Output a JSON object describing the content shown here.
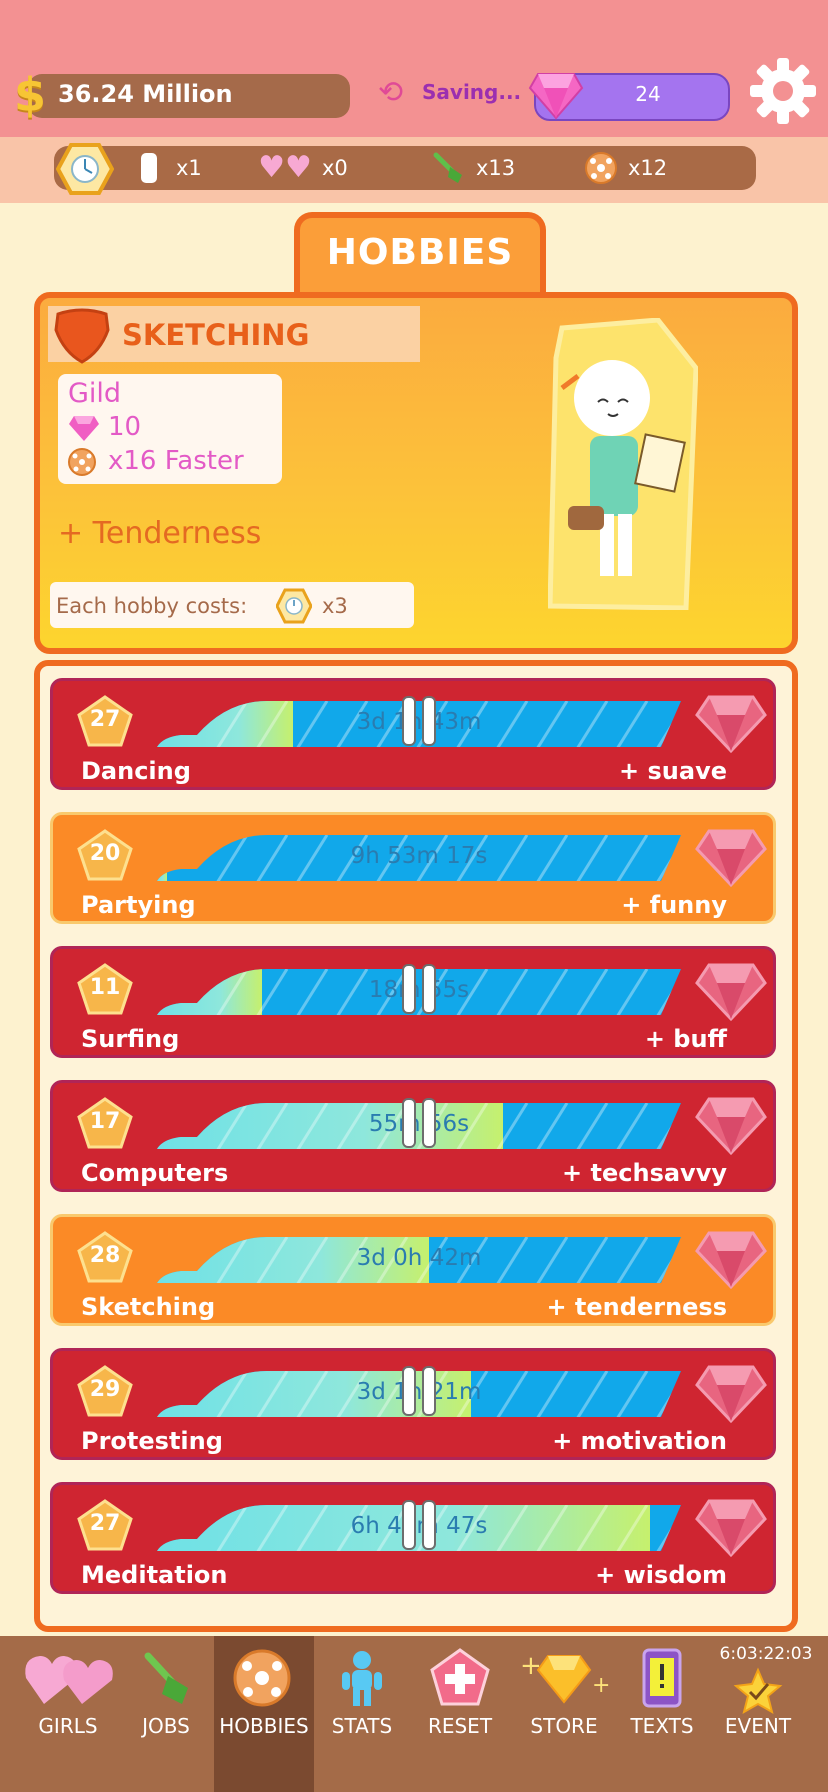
{
  "header": {
    "money": "36.24 Million",
    "saving": "Saving...",
    "gems": "24"
  },
  "resources": [
    {
      "icon": "clock-hexagon-icon",
      "value": "x1"
    },
    {
      "icon": "pink-hearts-icon",
      "value": "x0"
    },
    {
      "icon": "shovel-icon",
      "value": "x13"
    },
    {
      "icon": "ball-icon",
      "value": "x12"
    }
  ],
  "panel": {
    "tab": "HOBBIES",
    "title": "SKETCHING",
    "gild_title": "Gild",
    "gild_gems": "10",
    "gild_faster": "x16 Faster",
    "bonus": "+ Tenderness",
    "cost_label": "Each hobby costs:",
    "cost_value": "x3"
  },
  "hobbies": [
    {
      "level": "27",
      "name": "Dancing",
      "bonus": "+ suave",
      "time": "3d 1h 43m",
      "progress": 0.26,
      "color": "red",
      "paused": true
    },
    {
      "level": "20",
      "name": "Partying",
      "bonus": "+ funny",
      "time": "9h 53m 17s",
      "progress": 0.02,
      "color": "orange",
      "paused": false
    },
    {
      "level": "11",
      "name": "Surfing",
      "bonus": "+ buff",
      "time": "18m 55s",
      "progress": 0.2,
      "color": "red",
      "paused": true
    },
    {
      "level": "17",
      "name": "Computers",
      "bonus": "+ techsavvy",
      "time": "55m 56s",
      "progress": 0.66,
      "color": "red",
      "paused": true
    },
    {
      "level": "28",
      "name": "Sketching",
      "bonus": "+ tenderness",
      "time": "3d 0h 42m",
      "progress": 0.52,
      "color": "orange",
      "paused": false
    },
    {
      "level": "29",
      "name": "Protesting",
      "bonus": "+ motivation",
      "time": "3d 1h 21m",
      "progress": 0.6,
      "color": "red",
      "paused": true
    },
    {
      "level": "27",
      "name": "Meditation",
      "bonus": "+ wisdom",
      "time": "6h 40m 47s",
      "progress": 0.94,
      "color": "red",
      "paused": true
    }
  ],
  "nav": [
    {
      "label": "GIRLS",
      "icon": "hearts-icon"
    },
    {
      "label": "JOBS",
      "icon": "shovel-icon"
    },
    {
      "label": "HOBBIES",
      "icon": "ball-icon",
      "active": true
    },
    {
      "label": "STATS",
      "icon": "person-icon"
    },
    {
      "label": "RESET",
      "icon": "plus-pentagon-icon"
    },
    {
      "label": "STORE",
      "icon": "gem-sparkle-icon"
    },
    {
      "label": "TEXTS",
      "icon": "phone-icon"
    },
    {
      "label": "EVENT",
      "icon": "star-icon"
    }
  ],
  "event_timer": "6:03:22:03",
  "colors": {
    "top": "#f39192",
    "accent": "#ef6b20",
    "row_red": "#cf2531",
    "row_orange": "#fb8a26",
    "bar": "#11a8ea"
  }
}
